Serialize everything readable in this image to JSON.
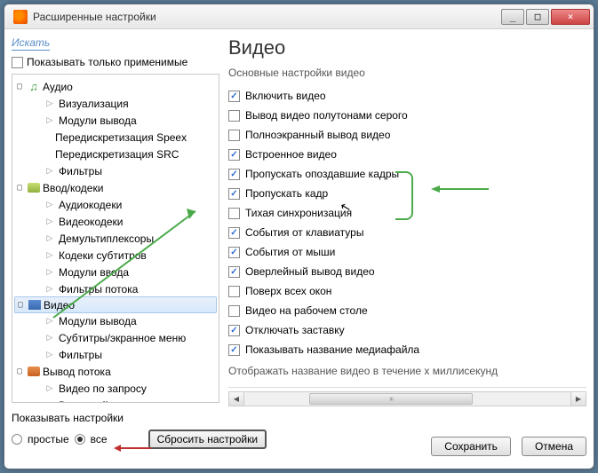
{
  "title": "Расширенные настройки",
  "search_label": "Искать",
  "applicable_label": "Показывать только применимые",
  "tree": {
    "audio": "Аудио",
    "visualization": "Визуализация",
    "output_modules": "Модули вывода",
    "speex": "Передискретизация Speex",
    "src": "Передискретизация SRC",
    "filters": "Фильтры",
    "input_codecs": "Ввод/кодеки",
    "audio_codecs": "Аудиокодеки",
    "video_codecs": "Видеокодеки",
    "demuxers": "Демультиплексоры",
    "sub_codecs": "Кодеки субтитров",
    "input_modules": "Модули ввода",
    "stream_filters": "Фильтры потока",
    "video": "Видео",
    "out_modules": "Модули вывода",
    "subs_osd": "Субтитры/экранное меню",
    "filters2": "Фильтры",
    "stream_out": "Вывод потока",
    "vod": "Видео по запросу",
    "out_stream": "Выходной поток",
    "etc": "..."
  },
  "heading": "Видео",
  "subheading": "Основные настройки видео",
  "options": {
    "enable": "Включить видео",
    "grayscale": "Вывод видео полутонами серого",
    "fullscreen": "Полноэкранный вывод видео",
    "embedded": "Встроенное видео",
    "skip_late": "Пропускать опоздавшие кадры",
    "skip_frames": "Пропускать кадр",
    "quiet_sync": "Тихая синхронизация",
    "kb_events": "События от клавиатуры",
    "mouse_events": "События от мыши",
    "overlay": "Оверлейный вывод видео",
    "on_top": "Поверх всех окон",
    "wallpaper": "Видео на рабочем столе",
    "disable_ss": "Отключать заставку",
    "show_title": "Показывать название медиафайла"
  },
  "footer_text": "Отображать название видео в течение x миллисекунд",
  "show_settings_label": "Показывать настройки",
  "radio_simple": "простые",
  "radio_all": "все",
  "reset_btn": "Сбросить настройки",
  "save_btn": "Сохранить",
  "cancel_btn": "Отмена",
  "winbtns": {
    "min": "_",
    "max": "□",
    "close": "✕"
  }
}
